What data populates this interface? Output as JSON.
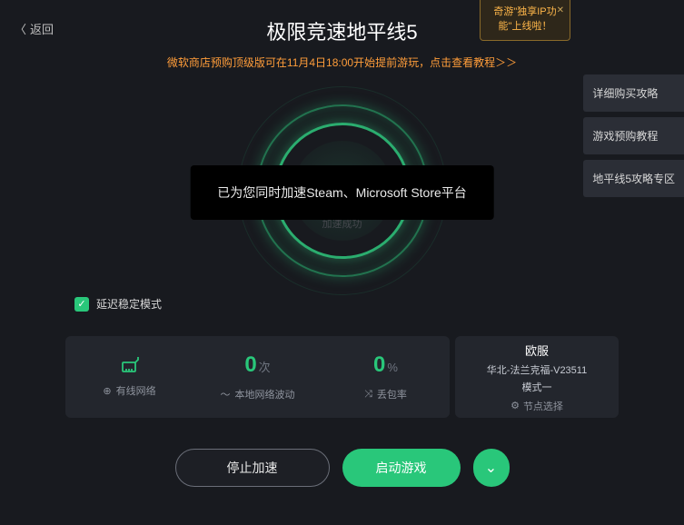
{
  "header": {
    "back_label": "返回",
    "title": "极限竞速地平线5",
    "subtitle": "微软商店预购顶级版可在11月4日18:00开始提前游玩，点击查看教程＞＞"
  },
  "promo": {
    "text": "奇游\"独享IP功能\"上线啦！"
  },
  "side_tabs": [
    "详细购买攻略",
    "游戏预购教程",
    "地平线5攻略专区"
  ],
  "gauge": {
    "value": "100",
    "sub": "加速成功"
  },
  "toast": "已为您同时加速Steam、Microsoft Store平台",
  "mode": {
    "label": "延迟稳定模式",
    "checked": true
  },
  "stats": {
    "col1_label": "有线网络",
    "col2_val": "0",
    "col2_unit": "次",
    "col2_label": "本地网络波动",
    "col3_val": "0",
    "col3_unit": "%",
    "col3_label": "丢包率"
  },
  "server": {
    "region": "欧服",
    "node": "华北-法兰克福-V23511",
    "mode": "模式一",
    "select_label": "节点选择"
  },
  "buttons": {
    "stop": "停止加速",
    "start": "启动游戏"
  }
}
